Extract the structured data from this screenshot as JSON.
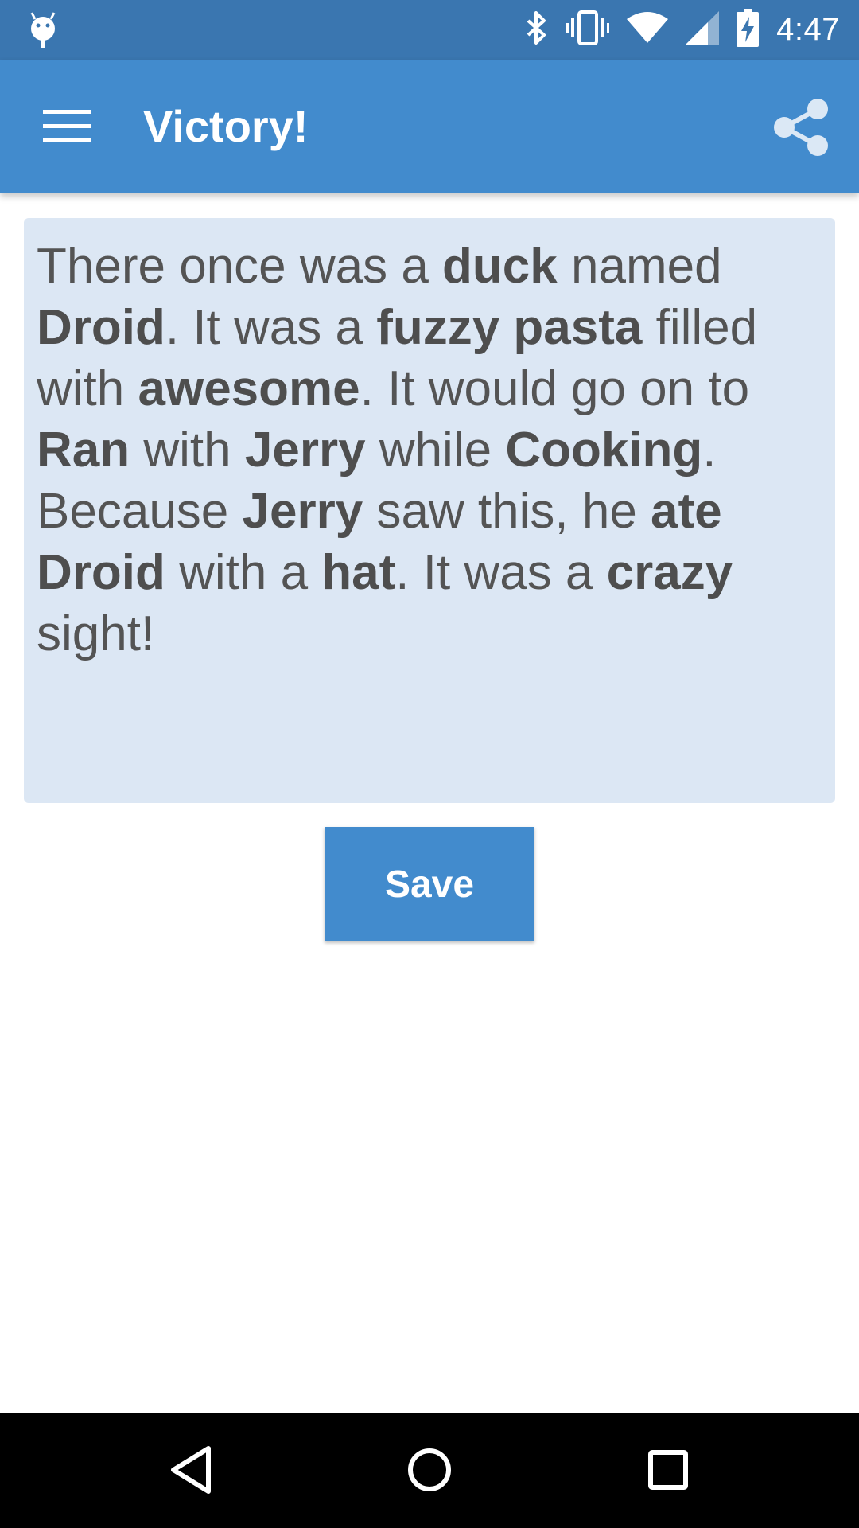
{
  "status_bar": {
    "time": "4:47",
    "icons": [
      "android-debug-icon",
      "bluetooth-icon",
      "vibrate-icon",
      "wifi-icon",
      "signal-icon",
      "battery-charging-icon"
    ]
  },
  "app_bar": {
    "title": "Victory!",
    "menu_icon": "hamburger-menu-icon",
    "share_icon": "share-icon"
  },
  "story": {
    "segments": [
      {
        "text": "There once was a ",
        "bold": false
      },
      {
        "text": "duck",
        "bold": true
      },
      {
        "text": " named ",
        "bold": false
      },
      {
        "text": "Droid",
        "bold": true
      },
      {
        "text": ". It was a ",
        "bold": false
      },
      {
        "text": "fuzzy pasta",
        "bold": true
      },
      {
        "text": " filled with ",
        "bold": false
      },
      {
        "text": "awesome",
        "bold": true
      },
      {
        "text": ". It would go on to ",
        "bold": false
      },
      {
        "text": "Ran",
        "bold": true
      },
      {
        "text": " with ",
        "bold": false
      },
      {
        "text": "Jerry",
        "bold": true
      },
      {
        "text": " while ",
        "bold": false
      },
      {
        "text": "Cooking",
        "bold": true
      },
      {
        "text": ". Because ",
        "bold": false
      },
      {
        "text": "Jerry",
        "bold": true
      },
      {
        "text": " saw this, he ",
        "bold": false
      },
      {
        "text": "ate",
        "bold": true
      },
      {
        "text": " ",
        "bold": false
      },
      {
        "text": "Droid",
        "bold": true
      },
      {
        "text": " with a ",
        "bold": false
      },
      {
        "text": "hat",
        "bold": true
      },
      {
        "text": ". It was a ",
        "bold": false
      },
      {
        "text": "crazy",
        "bold": true
      },
      {
        "text": " sight!",
        "bold": false
      }
    ]
  },
  "save_button": {
    "label": "Save"
  },
  "nav_bar": {
    "icons": [
      "back-triangle-icon",
      "home-circle-icon",
      "recents-square-icon"
    ]
  },
  "colors": {
    "status_bar": "#3a76b0",
    "app_bar": "#428bcd",
    "story_background": "#dce7f4",
    "text": "#545454",
    "nav_bar": "#000000"
  }
}
